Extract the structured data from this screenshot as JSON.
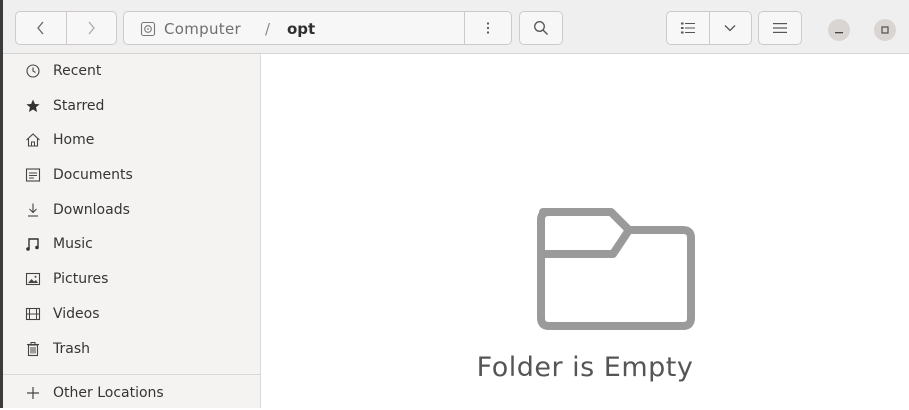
{
  "header": {
    "path": {
      "root": "Computer",
      "separator": "/",
      "current": "opt"
    },
    "icons": {
      "back": "chevron-left-icon",
      "forward": "chevron-right-icon",
      "root": "drive-icon",
      "menu": "vertical-dots-icon",
      "search": "search-icon",
      "view": "list-view-icon",
      "view_options": "chevron-down-icon",
      "main_menu": "hamburger-icon",
      "minimize": "minimize-icon",
      "maximize": "maximize-icon"
    }
  },
  "sidebar": {
    "items": [
      {
        "label": "Recent",
        "icon": "clock-icon"
      },
      {
        "label": "Starred",
        "icon": "star-icon"
      },
      {
        "label": "Home",
        "icon": "home-icon"
      },
      {
        "label": "Documents",
        "icon": "document-icon"
      },
      {
        "label": "Downloads",
        "icon": "download-icon"
      },
      {
        "label": "Music",
        "icon": "music-icon"
      },
      {
        "label": "Pictures",
        "icon": "picture-icon"
      },
      {
        "label": "Videos",
        "icon": "video-icon"
      },
      {
        "label": "Trash",
        "icon": "trash-icon"
      }
    ],
    "other_locations": {
      "label": "Other Locations",
      "icon": "plus-icon"
    }
  },
  "main": {
    "empty_message": "Folder is Empty",
    "empty_icon": "folder-icon"
  },
  "colors": {
    "header_bg": "#f0efef",
    "sidebar_bg": "#f4f3f2",
    "content_bg": "#ffffff",
    "folder_icon": "#9a9a9a"
  }
}
